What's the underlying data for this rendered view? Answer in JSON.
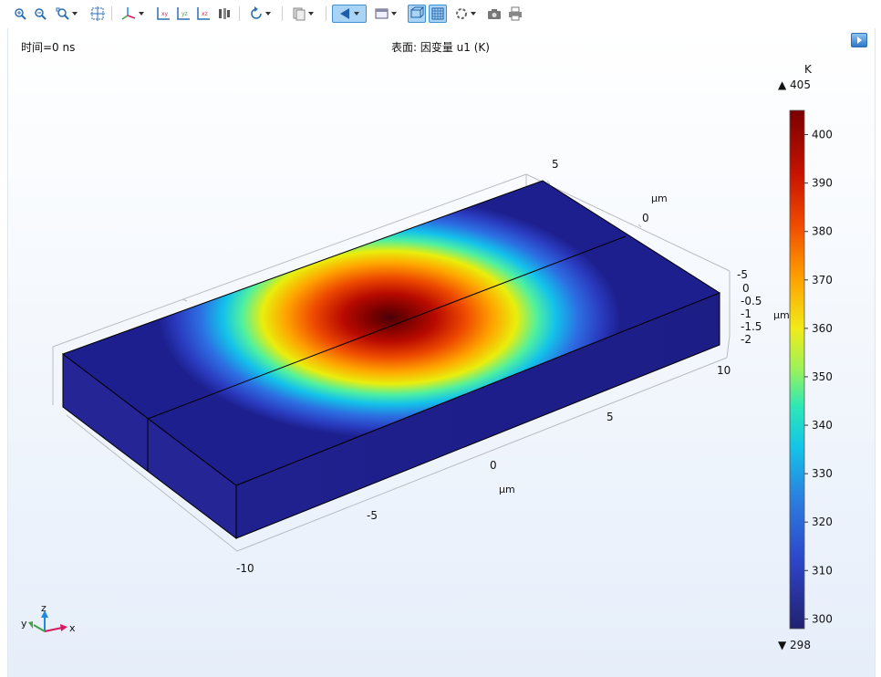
{
  "toolbar": {
    "buttons": [
      {
        "name": "zoom-in-button",
        "icon": "zoom-in-icon"
      },
      {
        "name": "zoom-out-button",
        "icon": "zoom-out-icon"
      },
      {
        "name": "zoom-box-button",
        "icon": "zoom-box-icon",
        "dropdown": true
      },
      {
        "name": "zoom-extents-button",
        "icon": "zoom-extents-icon"
      },
      {
        "name": "view-axes-button",
        "icon": "view-axes-icon",
        "dropdown": true
      },
      {
        "name": "view-xy-button",
        "icon": "view-xy-icon"
      },
      {
        "name": "view-yz-button",
        "icon": "view-yz-icon"
      },
      {
        "name": "view-xz-button",
        "icon": "view-xz-icon"
      },
      {
        "name": "go-to-default-view-button",
        "icon": "camera-reset-icon"
      },
      {
        "name": "rotate-button",
        "icon": "rotate-icon",
        "dropdown": true
      },
      {
        "name": "scene-light-button",
        "icon": "copy-view-icon",
        "dropdown": true
      },
      {
        "name": "play-animation-button",
        "icon": "play-icon",
        "dropdown": true,
        "active": true
      },
      {
        "name": "plot-settings-button",
        "icon": "window-icon",
        "dropdown": true
      },
      {
        "name": "wireframe-button",
        "icon": "wireframe-icon",
        "active": true
      },
      {
        "name": "grid-button",
        "icon": "grid-icon",
        "active": true
      },
      {
        "name": "reset-rotation-button",
        "icon": "refresh-icon",
        "dropdown": true
      },
      {
        "name": "screenshot-button",
        "icon": "camera-icon"
      },
      {
        "name": "print-button",
        "icon": "printer-icon"
      }
    ]
  },
  "header": {
    "time_label": "时间=0 ns",
    "plot_title": "表面: 因变量 u1 (K)"
  },
  "colors": {
    "block_dark": "#1c1c8c",
    "hot_center": "#4a0008",
    "legend_bar_top": "#7a0000",
    "legend_bar_bottom": "#21216f",
    "axis_x": "#d81b60",
    "axis_y": "#43a047",
    "axis_z": "#1e88e5"
  },
  "colorbar": {
    "unit": "K",
    "max_label": "▲ 405",
    "min_label": "▼ 298",
    "ticks": [
      {
        "value": 400,
        "label": "400"
      },
      {
        "value": 390,
        "label": "390"
      },
      {
        "value": 380,
        "label": "380"
      },
      {
        "value": 370,
        "label": "370"
      },
      {
        "value": 360,
        "label": "360"
      },
      {
        "value": 350,
        "label": "350"
      },
      {
        "value": 340,
        "label": "340"
      },
      {
        "value": 330,
        "label": "330"
      },
      {
        "value": 320,
        "label": "320"
      },
      {
        "value": 310,
        "label": "310"
      },
      {
        "value": 300,
        "label": "300"
      }
    ]
  },
  "axes": {
    "x_unit": "µm",
    "x_ticks": [
      "-10",
      "-5",
      "0",
      "5",
      "10"
    ],
    "y_unit": "µm",
    "y_ticks": [
      "0",
      "5"
    ],
    "z_unit": "µm",
    "z_ticks": [
      "-5",
      "0",
      "-0.5",
      "-1",
      "-1.5",
      "-2"
    ]
  },
  "triad": {
    "x": "x",
    "y": "y",
    "z": "z"
  }
}
